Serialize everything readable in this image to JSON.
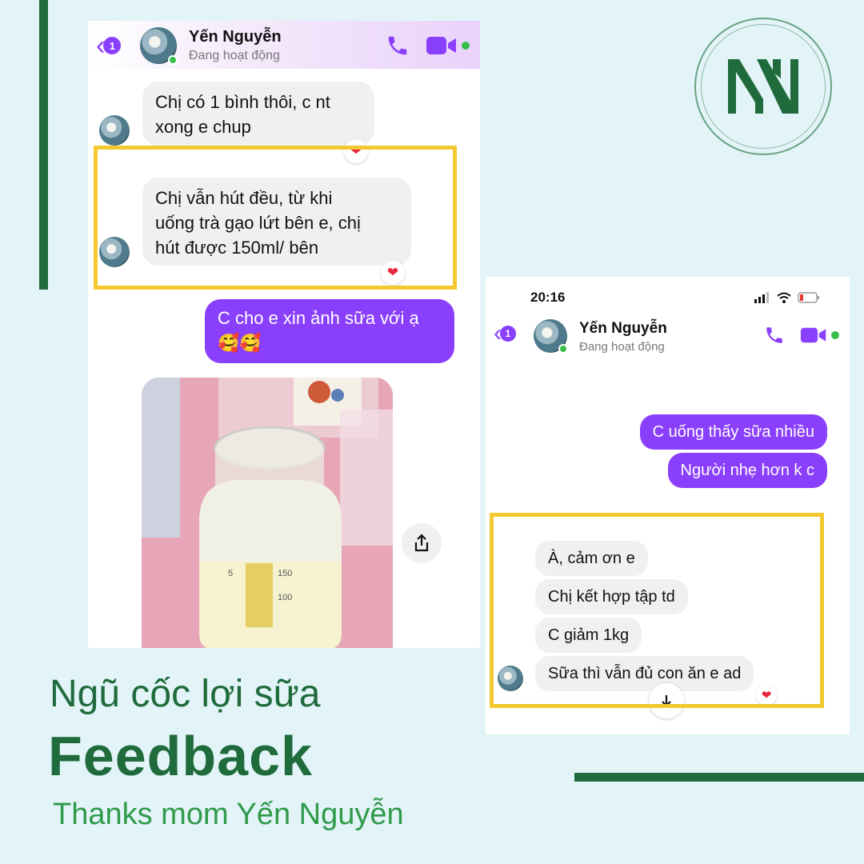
{
  "brand": {
    "logo_letters": "NY",
    "green": "#1f6b3c",
    "messenger_purple": "#8a3ffc",
    "highlight_yellow": "#f4c930"
  },
  "chat1": {
    "back_count": "1",
    "contact_name": "Yến Nguyễn",
    "contact_status": "Đang hoạt động",
    "messages": [
      {
        "text1": "Chị có 1 bình thôi, c nt",
        "text2": "xong e chup"
      },
      {
        "text1": "Chị vẫn hút đều, từ khi",
        "text2": "uống trà gạo lứt bên e, chị",
        "text3": "hút được 150ml/ bên"
      },
      {
        "text1": "C cho e xin ảnh sữa với ạ",
        "text2": "🥰🥰"
      }
    ],
    "bottle_marks": {
      "a": "5",
      "b": "150",
      "c": "100"
    }
  },
  "chat2": {
    "time": "20:16",
    "back_count": "1",
    "contact_name": "Yến Nguyễn",
    "contact_status": "Đang hoạt động",
    "outgoing": [
      "C uống thấy sữa nhiều",
      "Người nhẹ hơn k c"
    ],
    "incoming": [
      "À, cảm ơn e",
      "Chị kết hợp tập td",
      "C giảm 1kg",
      "Sữa thì vẫn đủ con ăn e ad"
    ]
  },
  "titles": {
    "line1": "Ngũ cốc lợi sữa",
    "line2": "Feedback",
    "line3": "Thanks mom Yến Nguyễn"
  }
}
